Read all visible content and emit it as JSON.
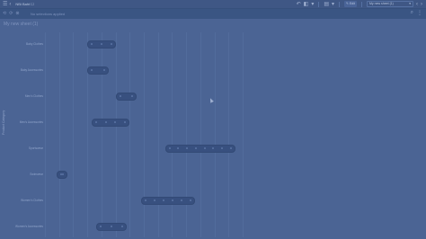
{
  "toolbar": {
    "app_title": "NBi Baht ☐",
    "sheet_selector": "My new sheet (1)",
    "edit_label": "Edit"
  },
  "selections": {
    "placeholder": "No selections applied"
  },
  "chart": {
    "title": "My new sheet (1)",
    "y_axis_label": "Product Category",
    "categories": [
      "Baby Clothes",
      "Baby Accessories",
      "Men's Clothes",
      "Men's Accessories",
      "Sportswear",
      "Swimwear",
      "Women's Clothes",
      "Women's Accessories"
    ]
  },
  "chart_data": {
    "type": "bar",
    "orientation": "horizontal-range",
    "categories": [
      "Baby Clothes",
      "Baby Accessories",
      "Men's Clothes",
      "Men's Accessories",
      "Sportswear",
      "Swimwear",
      "Women's Clothes",
      "Women's Accessories"
    ],
    "ranges": [
      [
        3,
        5
      ],
      [
        3,
        4.5
      ],
      [
        5,
        6.5
      ],
      [
        3.3,
        6
      ],
      [
        8.5,
        13.5
      ],
      [
        0.8,
        1.6
      ],
      [
        6.8,
        10.6
      ],
      [
        3.6,
        5.8
      ]
    ],
    "grid": true,
    "xlim": [
      0,
      14
    ]
  }
}
